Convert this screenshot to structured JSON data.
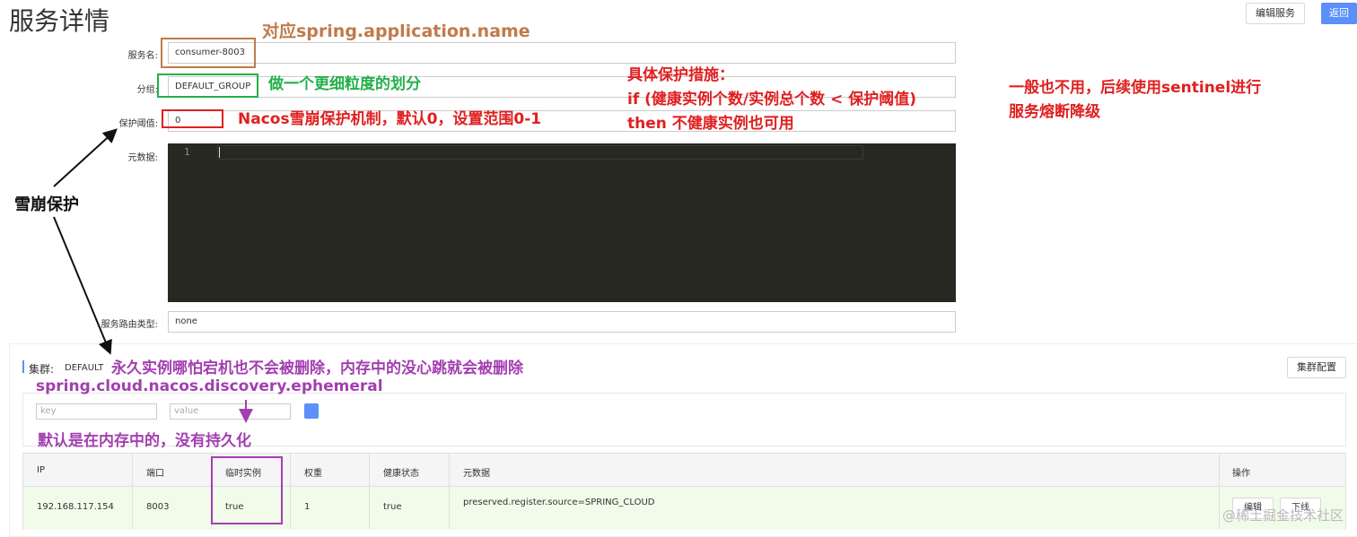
{
  "page": {
    "title": "服务详情"
  },
  "header_buttons": {
    "edit_service": "编辑服务",
    "back": "返回"
  },
  "form": {
    "service_name": {
      "label": "服务名:",
      "value": "consumer-8003"
    },
    "group": {
      "label": "分组:",
      "value": "DEFAULT_GROUP"
    },
    "protect_threshold": {
      "label": "保护阈值:",
      "value": "0"
    },
    "metadata": {
      "label": "元数据:",
      "line_number": "1"
    },
    "route_type": {
      "label": "服务路由类型:",
      "value": "none"
    }
  },
  "cluster": {
    "label": "集群:",
    "name": "DEFAULT",
    "config_button": "集群配置",
    "filter": {
      "key_placeholder": "key",
      "value_placeholder": "value"
    }
  },
  "table": {
    "columns": [
      "IP",
      "端口",
      "临时实例",
      "权重",
      "健康状态",
      "元数据",
      "操作"
    ],
    "rows": [
      {
        "ip": "192.168.117.154",
        "port": "8003",
        "ephemeral": "true",
        "weight": "1",
        "healthy": "true",
        "metadata": "preserved.register.source=SPRING_CLOUD",
        "edit": "编辑",
        "offline": "下线"
      }
    ]
  },
  "annotations": {
    "app_name": "对应spring.application.name",
    "group_note": "做一个更细粒度的划分",
    "nacos_protect": "Nacos雪崩保护机制，默认0，设置范围0-1",
    "protect_measure_1": "具体保护措施：",
    "protect_measure_2": "if (健康实例个数/实例总个数 < 保护阈值)",
    "protect_measure_3": "then 不健康实例也可用",
    "sentinel_1": "一般也不用，后续使用sentinel进行",
    "sentinel_2": "服务熔断降级",
    "avalanche": "雪崩保护",
    "persistent": "永久实例哪怕宕机也不会被删除，内存中的没心跳就会被删除",
    "ephemeral_prop": "spring.cloud.nacos.discovery.ephemeral",
    "default_memory": "默认是在内存中的，没有持久化"
  },
  "watermark": "@稀土掘金技术社区",
  "colors": {
    "primary": "#5b8ff9",
    "annotation_brown": "#c17a4a",
    "annotation_green": "#22b04a",
    "annotation_red": "#e02020",
    "annotation_purple": "#a23fb0",
    "row_highlight": "#f0fbe9",
    "editor_bg": "#272822"
  }
}
